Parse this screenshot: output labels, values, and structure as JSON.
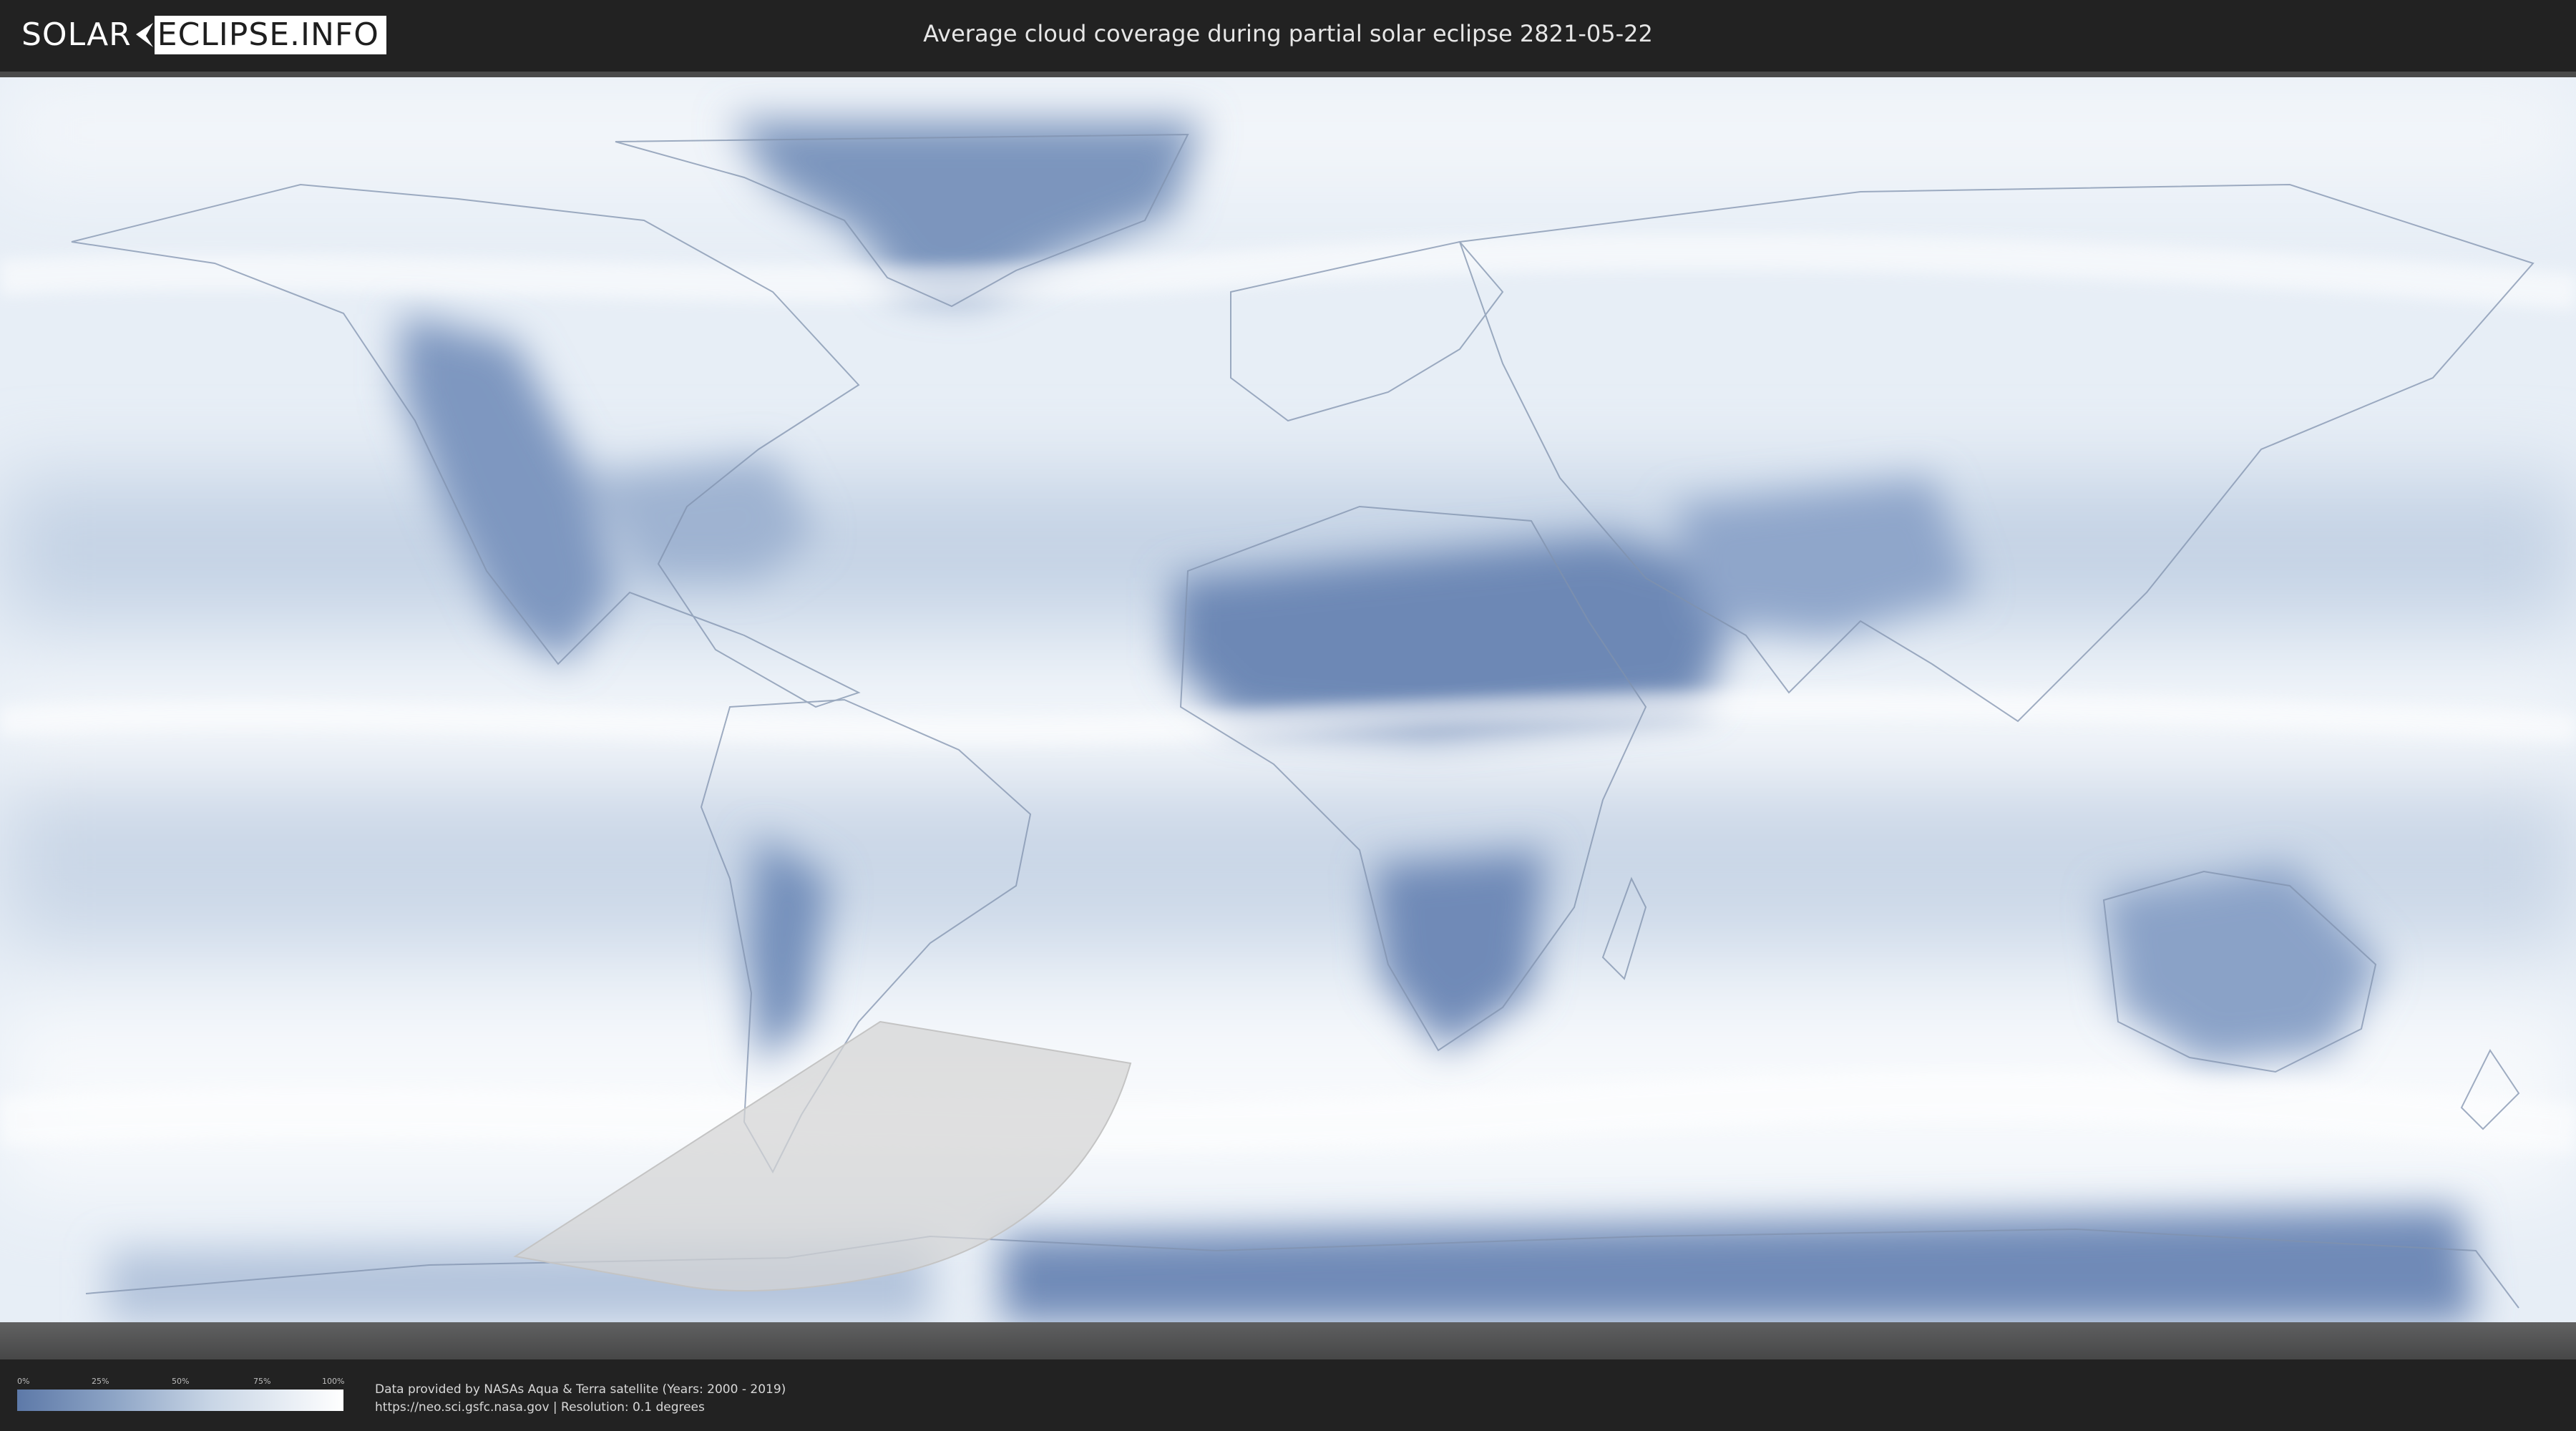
{
  "header": {
    "logo_part1": "SOLAR",
    "logo_part2": "ECLIPSE.INFO",
    "title": "Average cloud coverage during partial solar eclipse 2821-05-22"
  },
  "map": {
    "type": "cloud-coverage-world-map",
    "projection": "equirectangular",
    "eclipse_type": "partial",
    "eclipse_date": "2821-05-22",
    "eclipse_region_fill": "#d6d6d6",
    "cloud_clear_color": "#5d79a8",
    "cloud_full_color": "#ffffff"
  },
  "legend": {
    "ticks": [
      "0%",
      "25%",
      "50%",
      "75%",
      "100%"
    ],
    "tick_values": [
      0,
      25,
      50,
      75,
      100
    ],
    "gradient_start": "#5d79a8",
    "gradient_end": "#ffffff"
  },
  "footer": {
    "line1": "Data provided by NASAs Aqua & Terra satellite (Years: 2000 - 2019)",
    "line2": "https://neo.sci.gsfc.nasa.gov | Resolution: 0.1 degrees"
  }
}
